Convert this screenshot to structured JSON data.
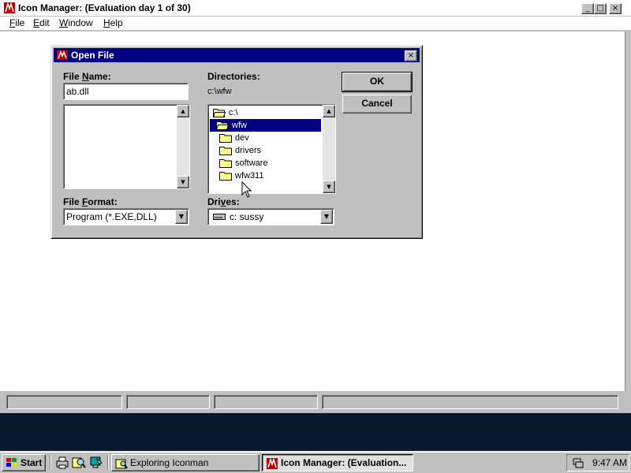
{
  "app": {
    "title": "Icon Manager: (Evaluation day 1 of 30)",
    "menu": [
      {
        "label": "File",
        "accel": "F",
        "rest": "ile"
      },
      {
        "label": "Edit",
        "accel": "E",
        "rest": "dit"
      },
      {
        "label": "Window",
        "accel": "W",
        "rest": "indow"
      },
      {
        "label": "Help",
        "accel": "H",
        "rest": "elp"
      }
    ],
    "window_controls": {
      "minimize": "_",
      "maximize": "□",
      "close": "×"
    }
  },
  "dialog": {
    "title": "Open File",
    "close": "×",
    "file_name_label_a": "File ",
    "file_name_label_accel": "N",
    "file_name_label_b": "ame:",
    "file_name_value": "ab.dll",
    "directories_label": "Directories:",
    "current_dir": "c:\\wfw",
    "dir_tree": [
      {
        "name": "c:\\",
        "selected": false,
        "open": true
      },
      {
        "name": "wfw",
        "selected": true,
        "open": true
      },
      {
        "name": "dev",
        "selected": false,
        "open": false
      },
      {
        "name": "drivers",
        "selected": false,
        "open": false
      },
      {
        "name": "software",
        "selected": false,
        "open": false
      },
      {
        "name": "wfw311",
        "selected": false,
        "open": false
      }
    ],
    "file_format_label_a": "File ",
    "file_format_label_accel": "F",
    "file_format_label_b": "ormat:",
    "file_format_value": "Program (*.EXE,DLL)",
    "drives_label_a": "Dri",
    "drives_label_accel": "v",
    "drives_label_b": "es:",
    "drive_value": "c: sussy",
    "ok_label": "OK",
    "cancel_label": "Cancel"
  },
  "taskbar": {
    "start_label": "Start",
    "tasks": [
      {
        "label": "Exploring Iconman",
        "active": false
      },
      {
        "label": "Icon Manager: (Evaluation...",
        "active": true
      }
    ],
    "clock": "9:47 AM"
  },
  "colors": {
    "titlebar_active": "#000080",
    "face": "#c0c0c0",
    "desktop": "#0a1a2e"
  }
}
